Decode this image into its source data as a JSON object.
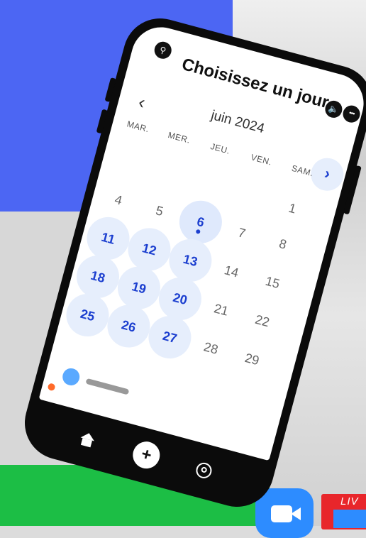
{
  "screen": {
    "title": "Choisissez un jour",
    "month": "juin 2024",
    "back_icon": "chevron-left-icon",
    "next_icon": "chevron-right-icon",
    "weekdays": [
      "MAR.",
      "MER.",
      "JEU.",
      "VEN.",
      "SAM."
    ],
    "days": {
      "d1": "1",
      "d4": "4",
      "d5": "5",
      "d6": "6",
      "d7": "7",
      "d8": "8",
      "d11": "11",
      "d12": "12",
      "d13": "13",
      "d14": "14",
      "d15": "15",
      "d18": "18",
      "d19": "19",
      "d20": "20",
      "d21": "21",
      "d22": "22",
      "d25": "25",
      "d26": "26",
      "d27": "27",
      "d28": "28",
      "d29": "29"
    },
    "available_days": [
      "6",
      "11",
      "12",
      "13",
      "18",
      "19",
      "20",
      "25",
      "26",
      "27"
    ],
    "today": "6"
  },
  "colors": {
    "accent": "#1c3fcf",
    "available_bg": "#e6eefc",
    "background_blue": "#4c66f3",
    "background_green": "#1cbe45"
  },
  "overlay": {
    "badge": "LIV"
  },
  "tabbar": {
    "items": [
      "home-icon",
      "add-icon",
      "profile-icon"
    ]
  }
}
